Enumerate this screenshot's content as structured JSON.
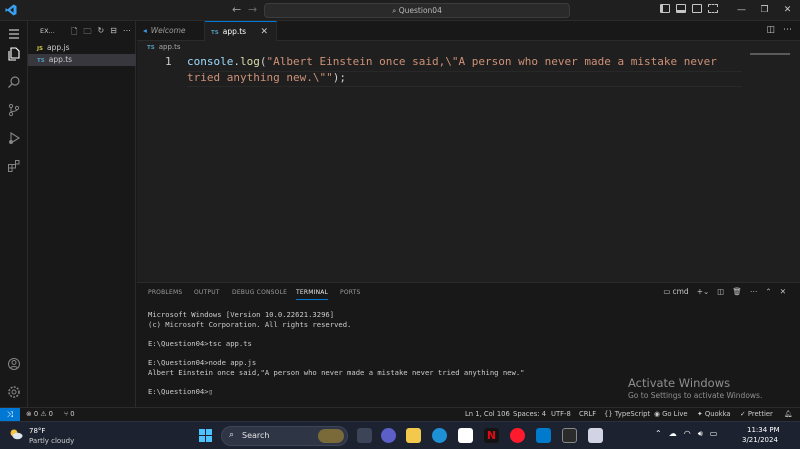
{
  "titlebar": {
    "search_text": "Question04",
    "win_min": "—",
    "win_max": "❐",
    "win_close": "✕"
  },
  "sidebar": {
    "header": "EX...",
    "files": [
      {
        "badge": "JS",
        "name": "app.js"
      },
      {
        "badge": "TS",
        "name": "app.ts"
      }
    ]
  },
  "tabs": [
    {
      "label": "Welcome"
    },
    {
      "badge": "TS",
      "label": "app.ts"
    }
  ],
  "editor": {
    "breadcrumb_badge": "TS",
    "breadcrumb": "app.ts",
    "line_number": "1",
    "code": {
      "obj": "console",
      "dot": ".",
      "fn": "log",
      "open": "(",
      "string_part1": "\"Albert Einstein once said,\\\"A person who never made a mistake never",
      "string_part2": "tried anything new.\\\"\"",
      "close": ");"
    }
  },
  "panel": {
    "tabs": [
      "PROBLEMS",
      "OUTPUT",
      "DEBUG CONSOLE",
      "TERMINAL",
      "PORTS"
    ],
    "active_tab": "TERMINAL",
    "shell_name": "cmd",
    "terminal_lines": [
      "Microsoft Windows [Version 10.0.22621.3296]",
      "(c) Microsoft Corporation. All rights reserved.",
      "",
      "E:\\Question04>tsc app.ts",
      "",
      "E:\\Question04>node app.js",
      "Albert Einstein once said,\"A person who never made a mistake never tried anything new.\"",
      "",
      "E:\\Question04>▯"
    ],
    "activate_title": "Activate Windows",
    "activate_sub": "Go to Settings to activate Windows."
  },
  "statusbar": {
    "problems": "⊗ 0 ⚠ 0",
    "ports": "⑂ 0",
    "cursor": "Ln 1, Col 106",
    "spaces": "Spaces: 4",
    "encoding": "UTF-8",
    "eol": "CRLF",
    "language": "{} TypeScript",
    "golive": "◉ Go Live",
    "quokka": "✦ Quokka",
    "prettier": "✓ Prettier"
  },
  "taskbar": {
    "temp": "78°F",
    "weather": "Partly cloudy",
    "search": "Search",
    "time": "11:34 PM",
    "date": "3/21/2024"
  },
  "colors": {
    "accent": "#0078d4",
    "editor_bg": "#1f1f1f",
    "string": "#ce9178",
    "function": "#dcdcaa",
    "variable": "#9cdcfe"
  }
}
